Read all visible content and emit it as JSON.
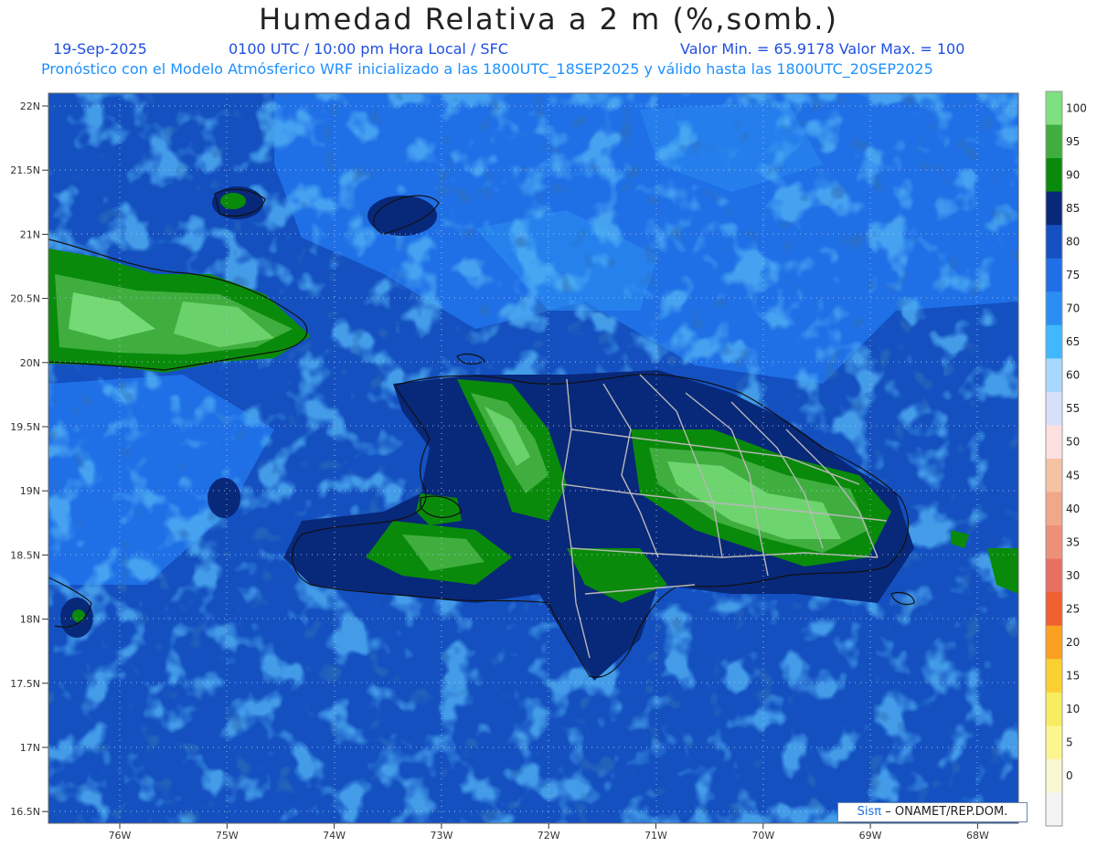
{
  "header": {
    "title": "Humedad Relativa a 2 m (%,somb.)",
    "date": "19-Sep-2025",
    "time": "0100 UTC / 10:00 pm Hora Local / SFC",
    "minmax": "Valor Min. = 65.9178  Valor Max. = 100",
    "model": "Pronóstico con el Modelo Atmósferico WRF inicializado a las 1800UTC_18SEP2025 y válido hasta las  1800UTC_20SEP2025"
  },
  "lat_labels": [
    "22N",
    "21.5N",
    "21N",
    "20.5N",
    "20N",
    "19.5N",
    "19N",
    "18.5N",
    "18N",
    "17.5N",
    "17N",
    "16.5N"
  ],
  "lon_labels": [
    "76W",
    "75W",
    "74W",
    "73W",
    "72W",
    "71W",
    "70W",
    "69W",
    "68W"
  ],
  "colorbar": {
    "labels": [
      "100",
      "95",
      "90",
      "85",
      "80",
      "75",
      "70",
      "65",
      "60",
      "55",
      "50",
      "45",
      "40",
      "35",
      "30",
      "25",
      "20",
      "15",
      "10",
      "5",
      "0"
    ],
    "colors": [
      "#7fe07f",
      "#3fae3f",
      "#0a8a0a",
      "#08287a",
      "#1450c0",
      "#1f6fe6",
      "#2b8ef2",
      "#3fb8ff",
      "#a8d8ff",
      "#d6e0fa",
      "#fde0e0",
      "#f6c2a4",
      "#f0a888",
      "#ec9078",
      "#e87060",
      "#f06030",
      "#fca020",
      "#fcd030",
      "#f8ec60",
      "#fcf690",
      "#f8f8d0",
      "#f4f4f4"
    ]
  },
  "credit": {
    "logo": "Sisπ",
    "text": "– ONAMET/REP.DOM."
  }
}
